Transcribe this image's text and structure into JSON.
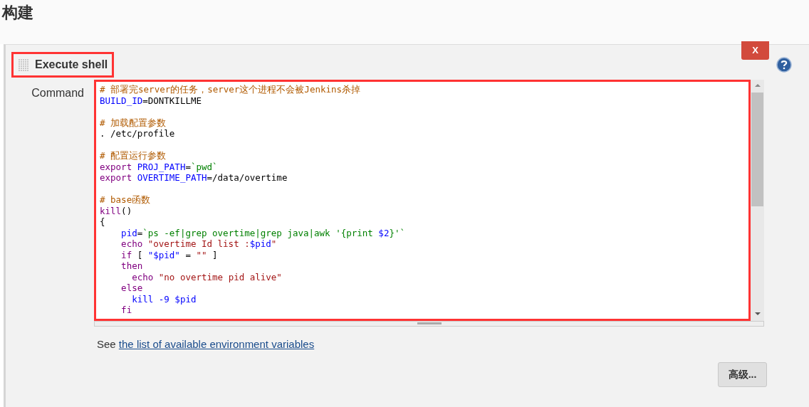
{
  "section_title": "构建",
  "step": {
    "title": "Execute shell",
    "close_label": "X"
  },
  "command": {
    "label": "Command",
    "blocks": [
      [
        [
          {
            "kind": "comment",
            "text": "# 部署完server的任务，server这个进程不会被Jenkins杀掉"
          }
        ],
        [
          {
            "kind": "variable",
            "text": "BUILD_ID"
          },
          {
            "kind": "plain",
            "text": "=DONTKILLME"
          }
        ]
      ],
      [
        [
          {
            "kind": "comment",
            "text": "# 加载配置参数"
          }
        ],
        [
          {
            "kind": "plain",
            "text": ". /etc/profile"
          }
        ]
      ],
      [
        [
          {
            "kind": "comment",
            "text": "# 配置运行参数"
          }
        ],
        [
          {
            "kind": "keyword",
            "text": "export "
          },
          {
            "kind": "variable",
            "text": "PROJ_PATH"
          },
          {
            "kind": "plain",
            "text": "="
          },
          {
            "kind": "command",
            "text": "`pwd`"
          }
        ],
        [
          {
            "kind": "keyword",
            "text": "export "
          },
          {
            "kind": "variable",
            "text": "OVERTIME_PATH"
          },
          {
            "kind": "plain",
            "text": "=/data/overtime"
          }
        ]
      ],
      [
        [
          {
            "kind": "comment",
            "text": "# base函数"
          }
        ],
        [
          {
            "kind": "keyword",
            "text": "kill"
          },
          {
            "kind": "plain",
            "text": "()"
          }
        ],
        [
          {
            "kind": "plain",
            "text": "{"
          }
        ],
        [
          {
            "kind": "variable",
            "text": "    pid"
          },
          {
            "kind": "plain",
            "text": "="
          },
          {
            "kind": "command",
            "text": "`ps -ef|grep overtime|grep java|awk '{print "
          },
          {
            "kind": "variable",
            "text": "$2"
          },
          {
            "kind": "command",
            "text": "}'`"
          }
        ],
        [
          {
            "kind": "keyword",
            "text": "    echo "
          },
          {
            "kind": "string",
            "text": "\"overtime Id list :"
          },
          {
            "kind": "variable",
            "text": "$pid"
          },
          {
            "kind": "string",
            "text": "\""
          }
        ],
        [
          {
            "kind": "keyword",
            "text": "    if"
          },
          {
            "kind": "plain",
            "text": " [ "
          },
          {
            "kind": "variable",
            "text": "\"$pid\""
          },
          {
            "kind": "plain",
            "text": " = "
          },
          {
            "kind": "string",
            "text": "\"\""
          },
          {
            "kind": "plain",
            "text": " ]"
          }
        ],
        [
          {
            "kind": "keyword",
            "text": "    then"
          }
        ],
        [
          {
            "kind": "keyword",
            "text": "      echo "
          },
          {
            "kind": "string",
            "text": "\"no overtime pid alive\""
          }
        ],
        [
          {
            "kind": "keyword",
            "text": "    else"
          }
        ],
        [
          {
            "kind": "variable",
            "text": "      kill -9 $pid"
          }
        ],
        [
          {
            "kind": "keyword",
            "text": "    fi"
          }
        ]
      ]
    ],
    "hint_prefix": "See ",
    "hint_link": "the list of available environment variables"
  },
  "advanced_button": "高级..."
}
